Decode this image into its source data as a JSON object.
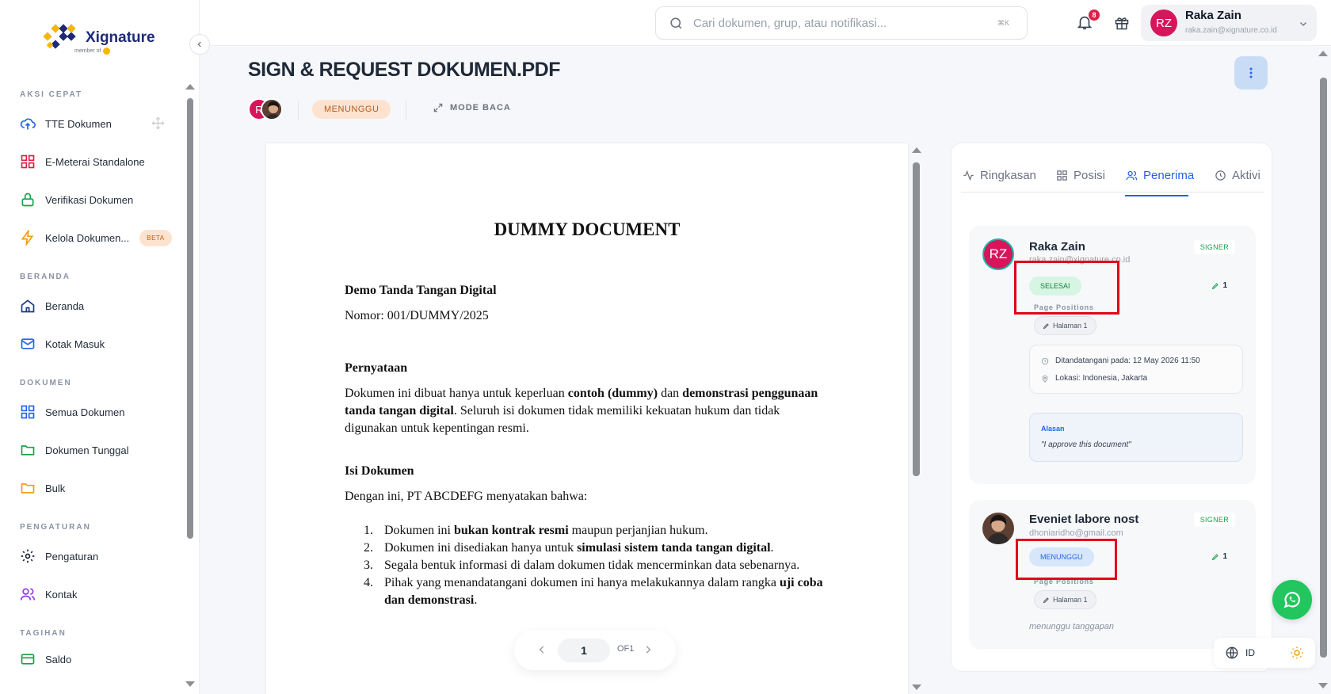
{
  "brand": {
    "name": "Xignature",
    "sub": "member of"
  },
  "search": {
    "placeholder": "Cari dokumen, grup, atau notifikasi...",
    "shortcut": "⌘K"
  },
  "notifications": {
    "count": "8"
  },
  "user": {
    "initials": "RZ",
    "name": "Raka Zain",
    "email": "raka.zain@xignature.co.id"
  },
  "sidebar": {
    "sections": [
      {
        "title": "AKSI CEPAT",
        "items": [
          {
            "label": "TTE Dokumen",
            "icon": "cloud-upload-icon",
            "color": "#2563eb"
          },
          {
            "label": "E-Meterai Standalone",
            "icon": "grid-icon",
            "color": "#e11d48"
          },
          {
            "label": "Verifikasi Dokumen",
            "icon": "lock-icon",
            "color": "#16a34a"
          },
          {
            "label": "Kelola Dokumen...",
            "icon": "lightning-icon",
            "color": "#f59e0b",
            "badge": "BETA"
          }
        ]
      },
      {
        "title": "BERANDA",
        "items": [
          {
            "label": "Beranda",
            "icon": "home-icon",
            "color": "#1e3a8a"
          },
          {
            "label": "Kotak Masuk",
            "icon": "mail-icon",
            "color": "#2563eb"
          }
        ]
      },
      {
        "title": "DOKUMEN",
        "items": [
          {
            "label": "Semua Dokumen",
            "icon": "grid-icon",
            "color": "#2563eb"
          },
          {
            "label": "Dokumen Tunggal",
            "icon": "folder-icon",
            "color": "#16a34a"
          },
          {
            "label": "Bulk",
            "icon": "folder-icon",
            "color": "#f59e0b"
          }
        ]
      },
      {
        "title": "PENGATURAN",
        "items": [
          {
            "label": "Pengaturan",
            "icon": "gear-icon",
            "color": "#1f2937"
          },
          {
            "label": "Kontak",
            "icon": "users-icon",
            "color": "#9333ea"
          }
        ]
      },
      {
        "title": "TAGIHAN",
        "items": [
          {
            "label": "Saldo",
            "icon": "wallet-icon",
            "color": "#16a34a"
          }
        ]
      }
    ]
  },
  "document": {
    "title": "SIGN & REQUEST DOKUMEN.PDF",
    "avatar_initial": "R",
    "status": "MENUNGGU",
    "mode_label": "MODE BACA"
  },
  "paper": {
    "heading": "DUMMY DOCUMENT",
    "subtitle": "Demo Tanda Tangan Digital",
    "number": "Nomor: 001/DUMMY/2025",
    "section1_title": "Pernyataan",
    "section1_p1": "Dokumen ini dibuat hanya untuk keperluan ",
    "section1_b1": "contoh (dummy)",
    "section1_p2": " dan ",
    "section1_b2": "demonstrasi penggunaan",
    "section1_b3": "tanda tangan digital",
    "section1_p3": ". Seluruh isi dokumen tidak memiliki kekuatan hukum dan tidak",
    "section1_p4": "digunakan untuk kepentingan resmi.",
    "section2_title": "Isi Dokumen",
    "section2_intro": "Dengan ini, PT ABCDEFG menyatakan bahwa:",
    "list": [
      {
        "n": "1.",
        "pre": "Dokumen ini ",
        "b": "bukan kontrak resmi",
        "post": " maupun perjanjian hukum."
      },
      {
        "n": "2.",
        "pre": "Dokumen ini disediakan hanya untuk ",
        "b": "simulasi sistem tanda tangan digital",
        "post": "."
      },
      {
        "n": "3.",
        "pre": "Segala bentuk informasi di dalam dokumen tidak mencerminkan data sebenarnya.",
        "b": "",
        "post": ""
      },
      {
        "n": "4.",
        "pre": "Pihak yang menandatangani dokumen ini hanya melakukannya dalam rangka ",
        "b": "uji coba",
        "post": ""
      }
    ],
    "list4_cont_b": "dan demonstrasi",
    "list4_cont_post": "."
  },
  "pager": {
    "current": "1",
    "of": "OF1"
  },
  "panel": {
    "tabs": [
      "Ringkasan",
      "Posisi",
      "Penerima",
      "Aktivi"
    ],
    "active_tab": "Penerima",
    "recipients": [
      {
        "initials": "RZ",
        "name": "Raka Zain",
        "email": "raka.zain@xignature.co.id",
        "role": "SIGNER",
        "status": "SELESAI",
        "count": "1",
        "positions_label": "Page Positions",
        "page": "Halaman 1",
        "signed_at": "Ditandatangani pada: 12 May 2026 11:50",
        "location": "Lokasi: Indonesia, Jakarta",
        "reason_label": "Alasan",
        "reason": "\"I approve this document\""
      },
      {
        "name": "Eveniet labore nost",
        "email": "dhoniaridho@gmail.com",
        "role": "SIGNER",
        "status": "MENUNGGU",
        "count": "1",
        "positions_label": "Page Positions",
        "page": "Halaman 1",
        "waiting": "menunggu tanggapan"
      }
    ]
  },
  "footer": {
    "lang": "ID"
  },
  "colors": {
    "accent": "#2563eb",
    "brand": "#1e2a78",
    "highlight": "#e0061a",
    "waiting": "#fde3cf",
    "done": "#d7f5e3"
  }
}
